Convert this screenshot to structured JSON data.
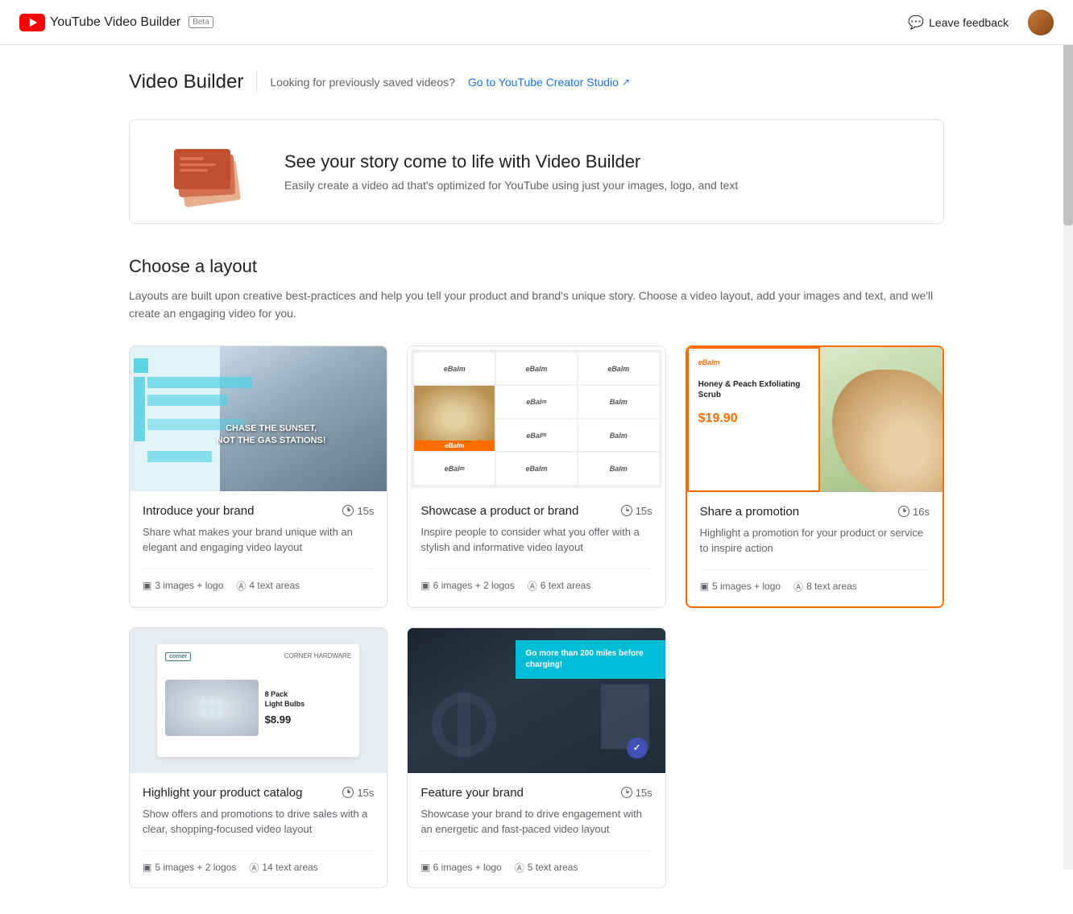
{
  "app": {
    "name": "YouTube Video Builder",
    "beta_label": "Beta",
    "logo_alt": "YouTube"
  },
  "header": {
    "leave_feedback_label": "Leave feedback",
    "saved_videos_text": "Looking for previously saved videos?",
    "studio_link_text": "Go to YouTube Creator Studio",
    "page_title": "Video Builder"
  },
  "hero": {
    "heading": "See your story come to life with Video Builder",
    "description": "Easily create a video ad that's optimized for YouTube using just your images, logo, and text"
  },
  "layouts_section": {
    "title": "Choose a layout",
    "description": "Layouts are built upon creative best-practices and help you tell your product and brand's unique story. Choose a video layout, add your images and text, and we'll create an engaging video for you."
  },
  "layouts": [
    {
      "id": "introduce",
      "name": "Introduce your brand",
      "duration": "15s",
      "description": "Share what makes your brand unique with an elegant and engaging video layout",
      "images": "3 images + logo",
      "text_areas": "4 text areas",
      "selected": false,
      "thumb_text": "CHASE THE SUNSET, NOT THE GAS STATIONS!"
    },
    {
      "id": "showcase",
      "name": "Showcase a product or brand",
      "duration": "15s",
      "description": "Inspire people to consider what you offer with a stylish and informative video layout",
      "images": "6 images + 2 logos",
      "text_areas": "6 text areas",
      "selected": false,
      "brand_name": "eBalm"
    },
    {
      "id": "promotion",
      "name": "Share a promotion",
      "duration": "16s",
      "description": "Highlight a promotion for your product or service to inspire action",
      "images": "5 images + logo",
      "text_areas": "8 text areas",
      "selected": true,
      "product_name": "Honey & Peach Exfoliating Scrub",
      "price": "$19.90",
      "brand": "eBalm"
    },
    {
      "id": "catalog",
      "name": "Highlight your product catalog",
      "duration": "15s",
      "description": "Show offers and promotions to drive sales with a clear, shopping-focused video layout",
      "images": "5 images + 2 logos",
      "text_areas": "14 text areas",
      "selected": false,
      "brand": "corner",
      "product": "8 Pack Light Bulbs",
      "price": "$8.99",
      "store": "CORNER HARDWARE"
    },
    {
      "id": "feature",
      "name": "Feature your brand",
      "duration": "15s",
      "description": "Showcase your brand to drive engagement with an energetic and fast-paced video layout",
      "images": "6 images + logo",
      "text_areas": "5 text areas",
      "selected": false,
      "text_overlay": "Go more than 200 miles before charging!"
    }
  ],
  "icons": {
    "feedback": "💬",
    "external_link": "↗",
    "image": "▣",
    "text": "Ⓐ",
    "clock": "⏱"
  }
}
